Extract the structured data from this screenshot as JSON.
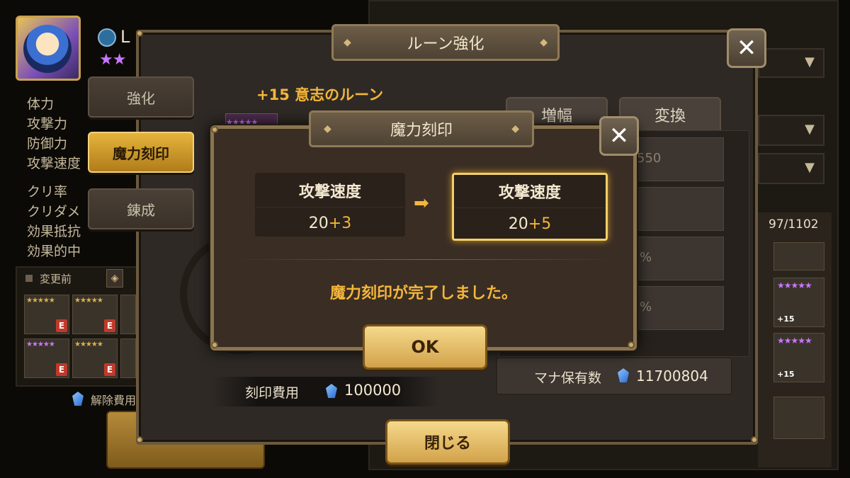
{
  "hero": {
    "name": "L",
    "stat_labels": [
      "体力",
      "攻撃力",
      "防御力",
      "攻撃速度",
      "クリ率",
      "クリダメ",
      "効果抵抗",
      "効果的中"
    ]
  },
  "side_menu": {
    "enhance": "強化",
    "enchant": "魔力刻印",
    "grind": "錬成"
  },
  "main_panel": {
    "title": "ルーン強化",
    "rune_name": "+15 意志のルーン",
    "tab_amplify": "増幅",
    "tab_convert": "変換",
    "partial_value": "550",
    "percent_1": "%",
    "percent_2": "%",
    "rune_count": "97/1102",
    "mana_label": "マナ保有数",
    "mana_value": "11700804",
    "cost_label": "刻印費用",
    "cost_value": "100000",
    "before_label": "変更前",
    "release_cost_label": "解除費用",
    "close_label": "閉じる",
    "enhance_level_badge": "+15"
  },
  "modal": {
    "title": "魔力刻印",
    "before": {
      "stat": "攻撃速度",
      "base": "20",
      "bonus": "+3"
    },
    "after": {
      "stat": "攻撃速度",
      "base": "20",
      "bonus": "+5"
    },
    "arrow": "➡",
    "message": "魔力刻印が完了しました。",
    "ok_label": "OK"
  },
  "badges": {
    "e": "E"
  },
  "colors": {
    "accent_gold": "#f3b63a",
    "highlight_border": "#f2cf6a"
  }
}
